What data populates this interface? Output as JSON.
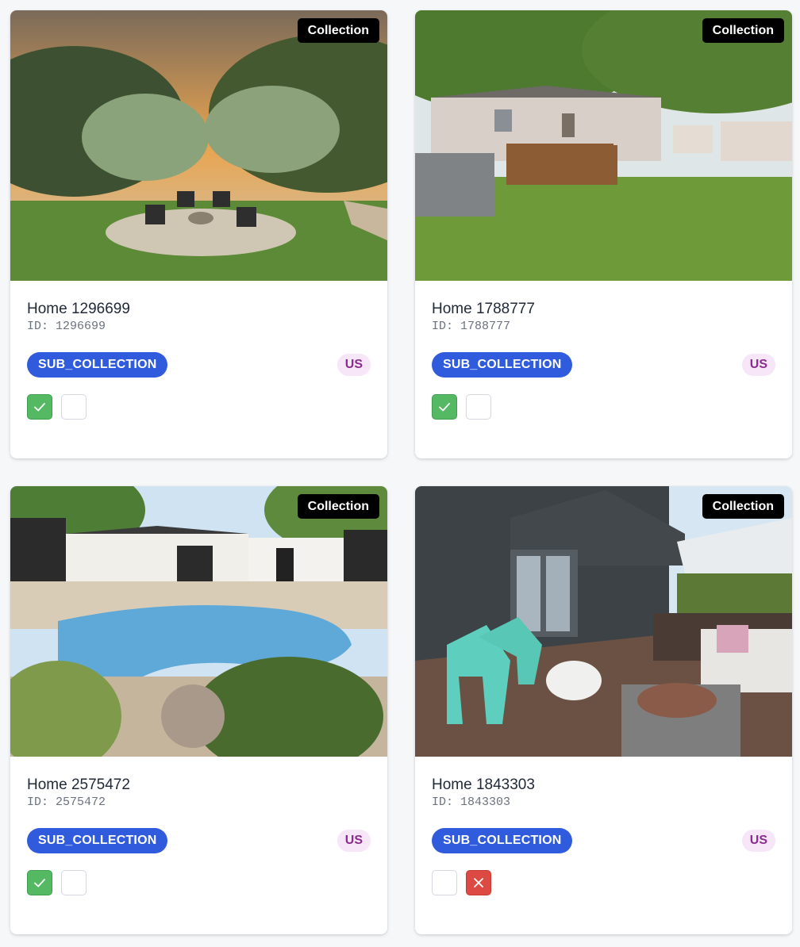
{
  "colors": {
    "sub_collection_badge": "#2f5bdc",
    "region_badge_bg": "#f6e6f7",
    "region_badge_text": "#8b2c8f",
    "approve_green": "#55b964",
    "reject_red": "#dd4a43",
    "collection_badge_bg": "#000000"
  },
  "listings": [
    {
      "collection_label": "Collection",
      "title": "Home 1296699",
      "id_text": "ID: 1296699",
      "sub_collection": "SUB_COLLECTION",
      "region": "US",
      "approve_checked": true,
      "reject_checked": false,
      "photo_subject": "backyard fire pit at sunset"
    },
    {
      "collection_label": "Collection",
      "title": "Home 1788777",
      "id_text": "ID: 1788777",
      "sub_collection": "SUB_COLLECTION",
      "region": "US",
      "approve_checked": true,
      "reject_checked": false,
      "photo_subject": "backyard with wooden deck"
    },
    {
      "collection_label": "Collection",
      "title": "Home 2575472",
      "id_text": "ID: 2575472",
      "sub_collection": "SUB_COLLECTION",
      "region": "US",
      "approve_checked": true,
      "reject_checked": false,
      "photo_subject": "backyard pool"
    },
    {
      "collection_label": "Collection",
      "title": "Home 1843303",
      "id_text": "ID: 1843303",
      "sub_collection": "SUB_COLLECTION",
      "region": "US",
      "approve_checked": false,
      "reject_checked": true,
      "photo_subject": "patio with adirondack chairs"
    }
  ],
  "icons": {
    "approve": "check-icon",
    "reject": "x-icon"
  }
}
